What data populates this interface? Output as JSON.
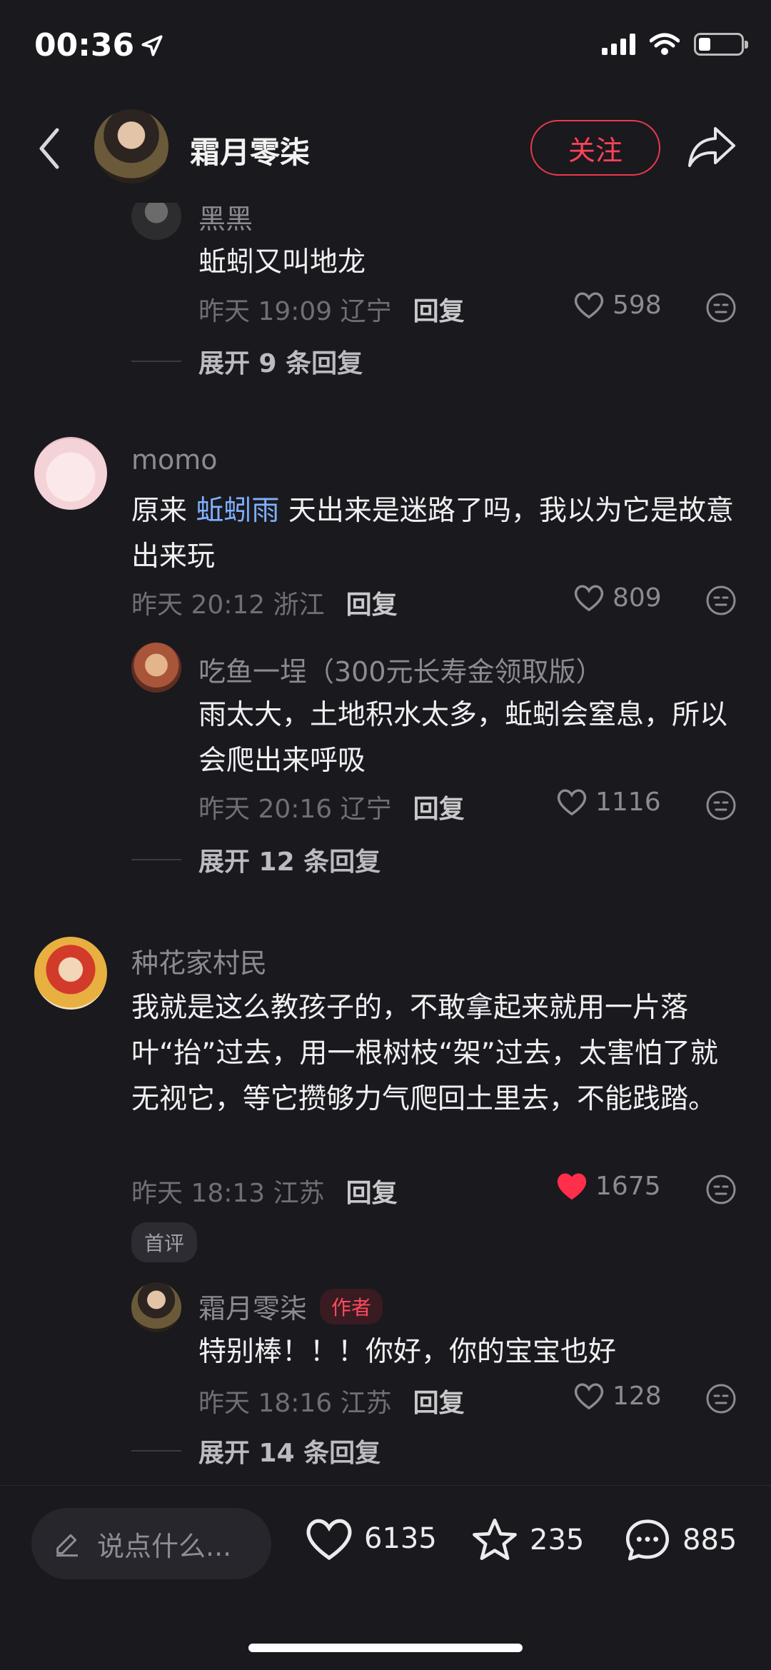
{
  "status": {
    "time": "00:36"
  },
  "header": {
    "title": "霜月零柒",
    "follow_label": "关注"
  },
  "comments": [
    {
      "name": "黑黑",
      "text": "蚯蚓又叫地龙",
      "date": "昨天 19:09",
      "location": "辽宁",
      "reply_label": "回复",
      "likes": "598",
      "expand": "展开 9 条回复"
    },
    {
      "name": "momo",
      "text_before": "原来 ",
      "text_link": "蚯蚓雨",
      "text_after": " 天出来是迷路了吗，我以为它是故意出来玩",
      "date": "昨天 20:12",
      "location": "浙江",
      "reply_label": "回复",
      "likes": "809",
      "reply": {
        "name": "吃鱼一埕（300元长寿金领取版）",
        "text": "雨太大，土地积水太多，蚯蚓会窒息，所以会爬出来呼吸",
        "date": "昨天 20:16",
        "location": "辽宁",
        "reply_label": "回复",
        "likes": "1116"
      },
      "expand": "展开 12 条回复"
    },
    {
      "name": "种花家村民",
      "text": "我就是这么教孩子的，不敢拿起来就用一片落叶“抬”过去，用一根树枝“架”过去，太害怕了就无视它，等它攒够力气爬回土里去，不能践踏。",
      "date": "昨天 18:13",
      "location": "江苏",
      "reply_label": "回复",
      "likes": "1675",
      "badge": "首评",
      "reply": {
        "name": "霜月零柒",
        "author_badge": "作者",
        "text": "特别棒！！！你好，你的宝宝也好",
        "date": "昨天 18:16",
        "location": "江苏",
        "reply_label": "回复",
        "likes": "128"
      },
      "expand": "展开 14 条回复"
    }
  ],
  "bottom": {
    "input_placeholder": "说点什么...",
    "likes": "6135",
    "favorites": "235",
    "comments": "885"
  },
  "colors": {
    "accent": "#ff4258",
    "link": "#7fb0ff",
    "liked": "#ff2e4a"
  },
  "icons": [
    "location-arrow-icon",
    "signal-icon",
    "wifi-icon",
    "battery-icon",
    "back-icon",
    "share-icon",
    "heart-icon",
    "emoji-icon",
    "pencil-icon",
    "star-icon",
    "comment-icon"
  ]
}
